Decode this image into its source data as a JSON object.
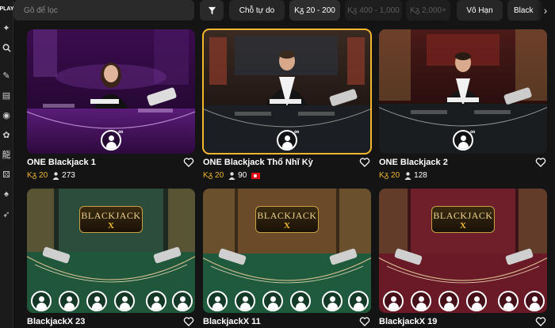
{
  "sidebar": {
    "logo_text": "PLAY",
    "icons": [
      "star-icon",
      "search-icon",
      "pen-icon",
      "cards-icon",
      "chip-icon",
      "dragon-tiger-icon",
      "dice-icon",
      "playing-card-icon",
      "rocket-icon"
    ]
  },
  "search": {
    "placeholder": "Gõ để lọc"
  },
  "filters": {
    "chips": [
      {
        "label": "Chỗ tự do",
        "state": "normal"
      },
      {
        "label": "Kᵹ 20 - 200",
        "state": "lit"
      },
      {
        "label": "Kᵹ 400 - 1,000",
        "state": "dim"
      },
      {
        "label": "Kᵹ 2,000+",
        "state": "dim"
      },
      {
        "label": "Vô Hạn",
        "state": "normal"
      },
      {
        "label": "Black",
        "state": "normal"
      }
    ]
  },
  "colors": {
    "accent": "#f3b72e",
    "background": "#141414",
    "card_selected_border": "#f3b72e"
  },
  "tables": [
    {
      "title": "ONE Blackjack 1",
      "limit": "Kᵹ 20",
      "players": "273",
      "flag": "",
      "theme": "purple"
    },
    {
      "title": "ONE Blackjack Thổ Nhĩ Kỳ",
      "limit": "Kᵹ 20",
      "players": "90",
      "flag": "turkey-flag",
      "theme": "dark",
      "selected": true
    },
    {
      "title": "ONE Blackjack 2",
      "limit": "Kᵹ 20",
      "players": "128",
      "flag": "",
      "theme": "red-gold"
    },
    {
      "title": "BlackjackX 23",
      "limit": "",
      "players": "",
      "flag": "",
      "theme": "green"
    },
    {
      "title": "BlackjackX 11",
      "limit": "",
      "players": "",
      "flag": "",
      "theme": "green-wood"
    },
    {
      "title": "BlackjackX 19",
      "limit": "",
      "players": "",
      "flag": "",
      "theme": "red"
    }
  ],
  "blackjackx_logo": {
    "word": "BLACKJACK",
    "mark": "X"
  },
  "infinity_symbol": "∞"
}
